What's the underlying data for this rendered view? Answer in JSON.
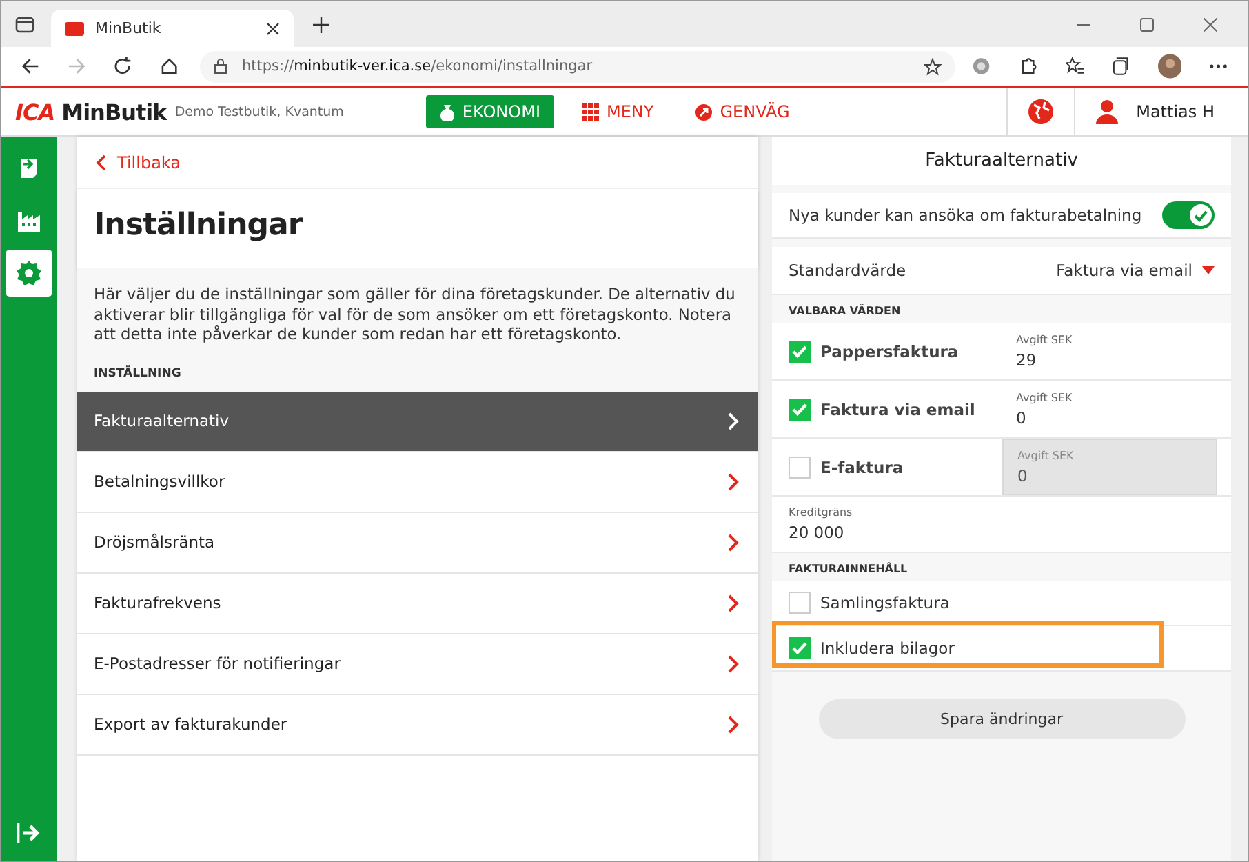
{
  "browser": {
    "tab_title": "MinButik",
    "url_prefix": "https://",
    "url_host": "minbutik-ver.ica.se",
    "url_path": "/ekonomi/installningar"
  },
  "header": {
    "logo_mark": "ICA",
    "logo_text": "MinButik",
    "store": "Demo Testbutik, Kvantum",
    "nav": [
      {
        "label": "EKONOMI",
        "selected": true
      },
      {
        "label": "MENY",
        "selected": false
      },
      {
        "label": "GENVÄG",
        "selected": false
      }
    ],
    "user": "Mattias H"
  },
  "sidebar": {
    "items": [
      {
        "selected": false
      },
      {
        "selected": false
      },
      {
        "selected": true
      }
    ]
  },
  "left": {
    "back": "Tillbaka",
    "title": "Inställningar",
    "description": "Här väljer du de inställningar som gäller för dina företagskunder. De alternativ du aktiverar blir tillgängliga för val för de som ansöker om ett företagskonto. Notera att detta inte påverkar de kunder som redan har ett företagskonto.",
    "section": "INSTÄLLNING",
    "items": [
      {
        "label": "Fakturaalternativ",
        "selected": true
      },
      {
        "label": "Betalningsvillkor",
        "selected": false
      },
      {
        "label": "Dröjsmålsränta",
        "selected": false
      },
      {
        "label": "Fakturafrekvens",
        "selected": false
      },
      {
        "label": "E-Postadresser för notifieringar",
        "selected": false
      },
      {
        "label": "Export av fakturakunder",
        "selected": false
      }
    ]
  },
  "right": {
    "title": "Fakturaalternativ",
    "toggle": {
      "label": "Nya kunder kan ansöka om fakturabetalning",
      "on": true
    },
    "default": {
      "label": "Standardvärde",
      "value": "Faktura via email"
    },
    "section_1": "VALBARA VÄRDEN",
    "options": [
      {
        "label": "Pappersfaktura",
        "checked": true,
        "fee_label": "Avgift SEK",
        "fee": "29",
        "disabled": false
      },
      {
        "label": "Faktura via email",
        "checked": true,
        "fee_label": "Avgift SEK",
        "fee": "0",
        "disabled": false
      },
      {
        "label": "E-faktura",
        "checked": false,
        "fee_label": "Avgift SEK",
        "fee": "0",
        "disabled": true
      }
    ],
    "credit": {
      "label": "Kreditgräns",
      "value": "20 000"
    },
    "section_2": "FAKTURAINNEHÅLL",
    "content": [
      {
        "label": "Samlingsfaktura",
        "checked": false,
        "highlighted": false
      },
      {
        "label": "Inkludera bilagor",
        "checked": true,
        "highlighted": true
      }
    ],
    "save": "Spara ändringar"
  }
}
